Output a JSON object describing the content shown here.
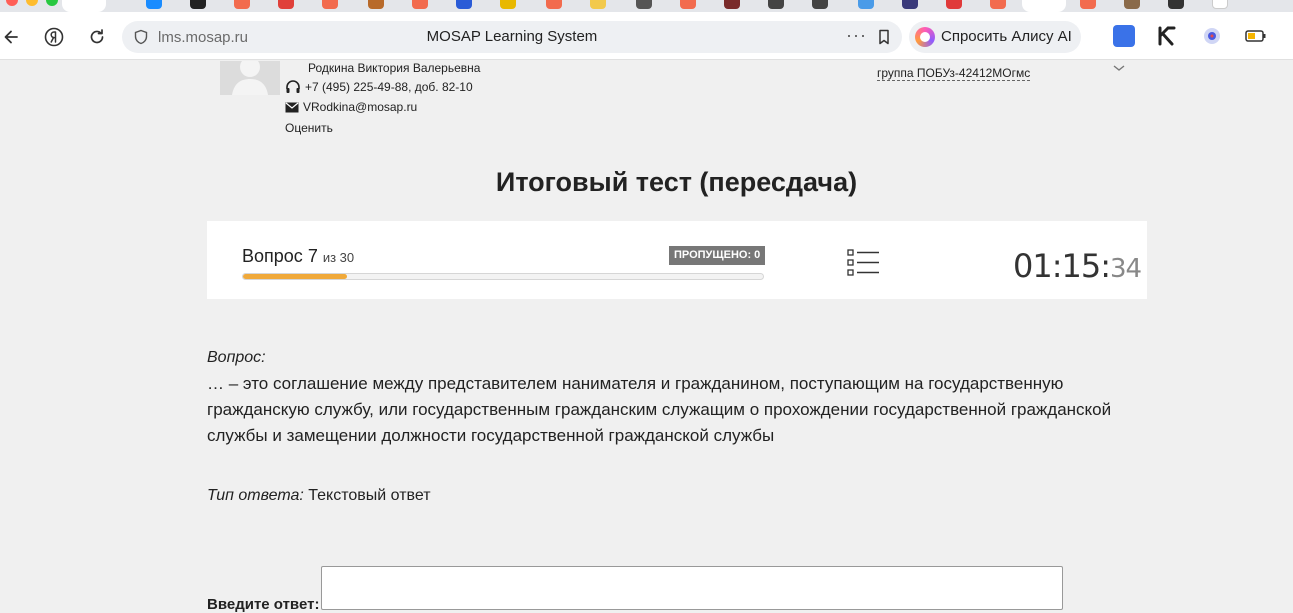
{
  "browser": {
    "url": "lms.mosap.ru",
    "page_title": "MOSAP Learning System",
    "alice_button": "Спросить Алису AI"
  },
  "teacher": {
    "name": "Родкина Виктория Валерьевна",
    "phone": "+7 (495) 225-49-88, доб. 82-10",
    "email": "VRodkina@mosap.ru",
    "rate_link": "Оценить"
  },
  "group": {
    "label": "группа ПОБУз-42412МОгмс"
  },
  "test": {
    "title": "Итоговый тест (пересдача)",
    "question_word": "Вопрос",
    "current": "7",
    "total_text": "из 30",
    "progress": 0.2,
    "skipped_badge": "ПРОПУЩЕНО: 0",
    "timer_main": "01:15:",
    "timer_seconds": "34"
  },
  "question": {
    "label": "Вопрос:",
    "text": "… – это соглашение между представителем нанимателя и гражданином, поступающим на государственную гражданскую службу, или государственным гражданским служащим о прохождении государственной гражданской службы и замещении должности государственной гражданской службы",
    "answer_type_label": "Тип ответа:",
    "answer_type_value": "Текстовый ответ",
    "answer_prompt": "Введите ответ:",
    "answer_value": ""
  },
  "colors": {
    "progress": "#f0a93a",
    "badge": "#777777",
    "page_bg": "#f0f0f0"
  }
}
